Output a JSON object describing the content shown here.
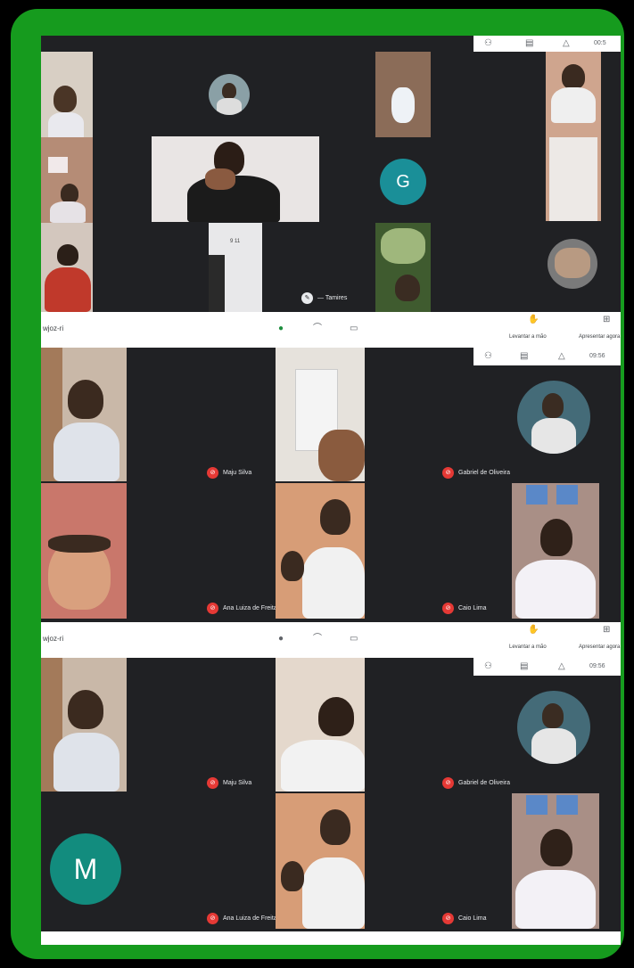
{
  "colors": {
    "frame": "#169b1e",
    "meet_bg": "#202124",
    "mic_off": "#e53935",
    "avatar_teal": "#1a8f98",
    "avatar_green": "#128c7e"
  },
  "shot1": {
    "avatar_letter": "G",
    "presenter_label": "— Tamires",
    "status_icons": [
      "people-icon",
      "chat-icon",
      "activities-icon"
    ],
    "time_fragment": "00:5"
  },
  "shot2": {
    "bar": {
      "meeting_code": "wjoz-ri",
      "actions": [
        "Levantar a mão",
        "Apresentar agora"
      ],
      "time": "09:56"
    },
    "tiles": [
      {
        "name": "Maju Silva"
      },
      {
        "name": "Gabriel de Oliveira"
      },
      {
        "name": "Ana Luiza de Freitas"
      },
      {
        "name": "Caio Lima"
      }
    ]
  },
  "shot3": {
    "bar": {
      "meeting_code": "wjoz-ri",
      "actions": [
        "Levantar a mão",
        "Apresentar agora"
      ],
      "time": "09:56"
    },
    "tiles": [
      {
        "name": "Maju Silva"
      },
      {
        "name": "Gabriel de Oliveira"
      },
      {
        "name": "Ana Luiza de Freitas"
      },
      {
        "name": "Caio Lima"
      }
    ],
    "avatar_letter": "M"
  }
}
